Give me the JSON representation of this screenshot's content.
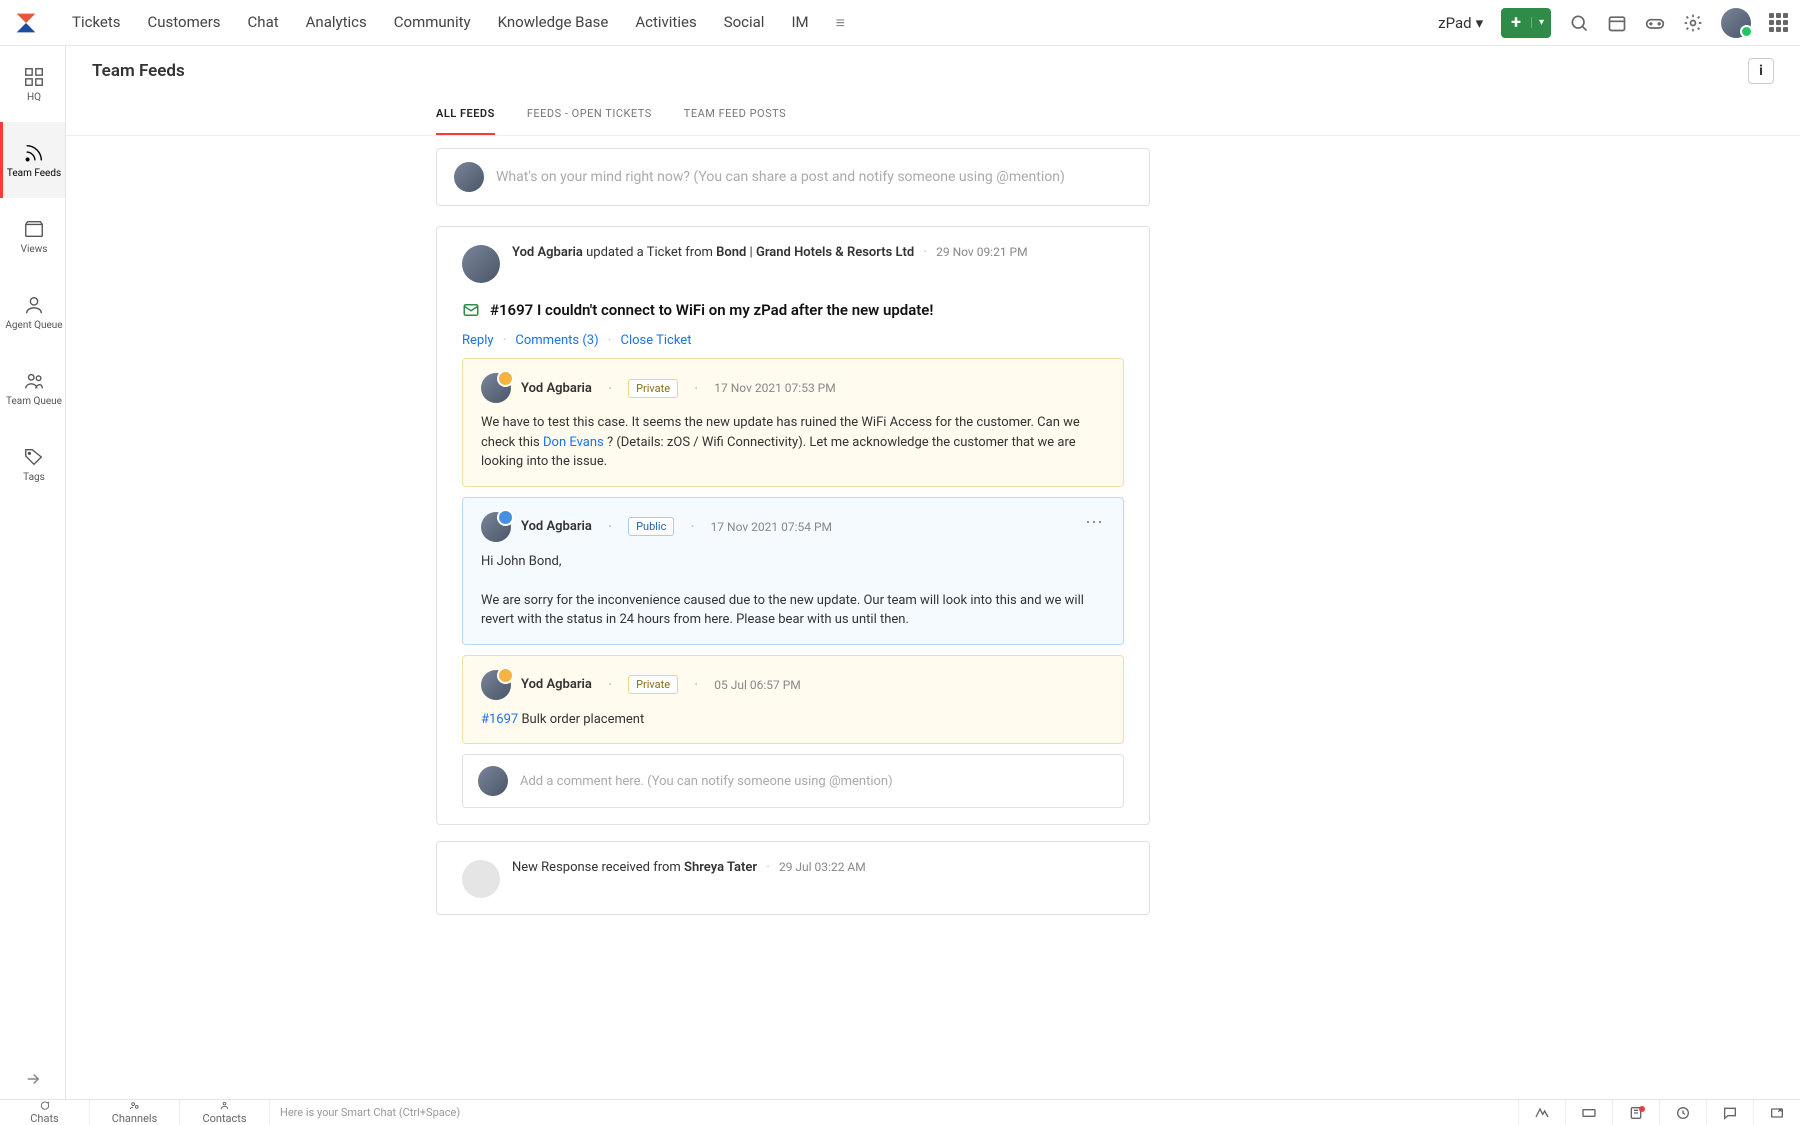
{
  "topnav": {
    "tabs": [
      "Tickets",
      "Customers",
      "Chat",
      "Analytics",
      "Community",
      "Knowledge Base",
      "Activities",
      "Social",
      "IM"
    ],
    "workspace": "zPad"
  },
  "leftrail": {
    "items": [
      {
        "label": "HQ"
      },
      {
        "label": "Team Feeds"
      },
      {
        "label": "Views"
      },
      {
        "label": "Agent Queue"
      },
      {
        "label": "Team Queue"
      },
      {
        "label": "Tags"
      }
    ]
  },
  "page": {
    "title": "Team Feeds"
  },
  "feed_tabs": {
    "all": "ALL FEEDS",
    "open": "FEEDS - OPEN TICKETS",
    "posts": "TEAM FEED POSTS"
  },
  "composer": {
    "placeholder": "What's on your mind right now? (You can share a post and notify someone using @mention)"
  },
  "feed1": {
    "actor": "Yod Agbaria",
    "verb": " updated a Ticket from ",
    "target": "Bond",
    "sep": " | ",
    "org": "Grand Hotels & Resorts Ltd",
    "timestamp": "29 Nov 09:21 PM",
    "ticket_title": "#1697 I couldn't connect to WiFi on my zPad after the new update!",
    "actions": {
      "reply": "Reply",
      "comments": "Comments (3)",
      "close": "Close Ticket"
    },
    "c1": {
      "author": "Yod Agbaria",
      "badge": "Private",
      "ts": "17 Nov 2021 07:53 PM",
      "body_a": "We have to test this case. It seems the new update has ruined the WiFi Access for the customer. Can we check this ",
      "mention": "Don Evans",
      "body_b": " ? (Details: zOS / Wifi Connectivity). Let me acknowledge the customer that we are looking into the issue."
    },
    "c2": {
      "author": "Yod Agbaria",
      "badge": "Public",
      "ts": "17 Nov 2021 07:54 PM",
      "body_line1": "Hi John Bond,",
      "body_line2": "We are sorry for the inconvenience caused due to the new update. Our team will look into this and we will revert with the status in 24 hours from here. Please bear with us until then."
    },
    "c3": {
      "author": "Yod Agbaria",
      "badge": "Private",
      "ts": "05 Jul 06:57 PM",
      "link": "#1697",
      "body": " Bulk order placement"
    },
    "add_comment_ph": "Add a comment here. (You can notify someone using @mention)"
  },
  "feed2": {
    "prefix": "New Response received from ",
    "actor": "Shreya Tater",
    "timestamp": "29 Jul 03:22 AM"
  },
  "bottombar": {
    "chats": "Chats",
    "channels": "Channels",
    "contacts": "Contacts",
    "hint": "Here is your Smart Chat (Ctrl+Space)"
  }
}
